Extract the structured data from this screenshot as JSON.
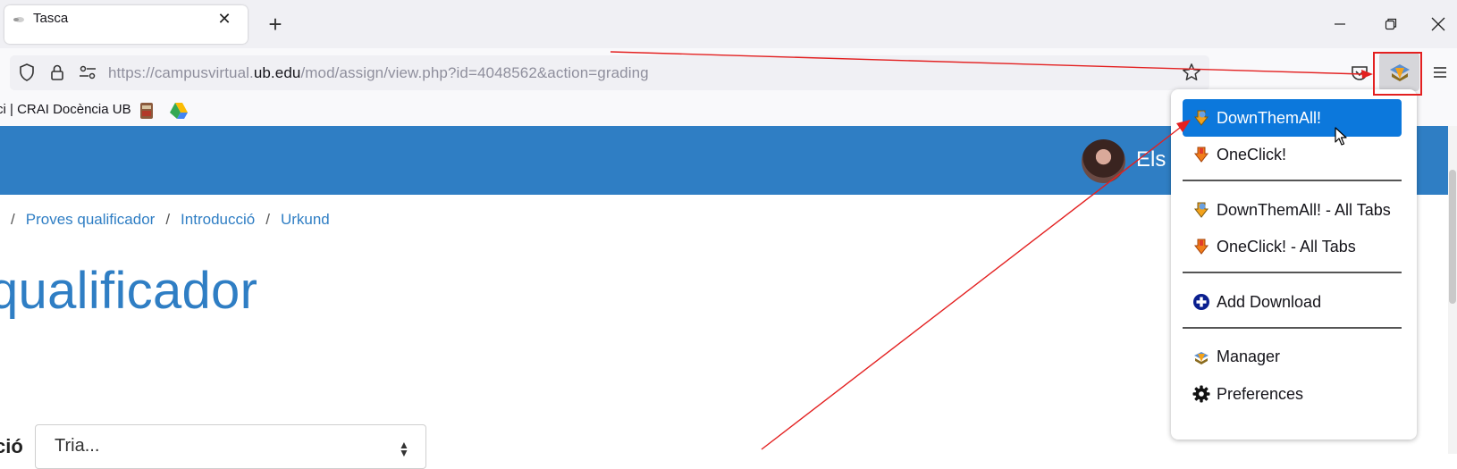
{
  "browser": {
    "tab": {
      "title": "Tasca"
    },
    "url": {
      "prefix": "https://campusvirtual.",
      "domain": "ub.edu",
      "path": "/mod/assign/view.php?id=4048562&action=grading"
    },
    "bookmarks": {
      "text": "ci | CRAI Docència UB"
    }
  },
  "page": {
    "user_name": "Els",
    "breadcrumb": [
      "Proves qualificador",
      "Introducció",
      "Urkund"
    ],
    "heading": "qualificador",
    "select": {
      "label": "ció",
      "value": "Tria..."
    }
  },
  "popup": {
    "items": [
      {
        "label": "DownThemAll!",
        "icon": "downthemall-icon",
        "active": true
      },
      {
        "label": "OneClick!",
        "icon": "oneclick-icon",
        "active": false
      },
      {
        "label": "DownThemAll! - All Tabs",
        "icon": "downthemall-icon",
        "active": false
      },
      {
        "label": "OneClick! - All Tabs",
        "icon": "oneclick-icon",
        "active": false
      },
      {
        "label": "Add Download",
        "icon": "add-circle-icon",
        "active": false
      },
      {
        "label": "Manager",
        "icon": "manager-icon",
        "active": false
      },
      {
        "label": "Preferences",
        "icon": "gear-icon",
        "active": false
      }
    ]
  },
  "colors": {
    "accent": "#2f7ec4",
    "menu_active": "#0c78dc",
    "annotation": "#e32020"
  }
}
